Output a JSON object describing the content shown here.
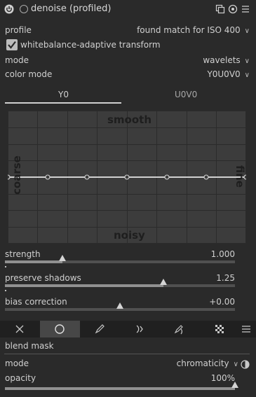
{
  "header": {
    "title": "denoise (profiled)"
  },
  "profile": {
    "label": "profile",
    "value": "found match for ISO 400"
  },
  "whitebalance": {
    "label": "whitebalance-adaptive transform",
    "checked": true
  },
  "mode": {
    "label": "mode",
    "value": "wavelets"
  },
  "color_mode": {
    "label": "color mode",
    "value": "Y0U0V0"
  },
  "tabs": [
    {
      "label": "Y0",
      "active": true
    },
    {
      "label": "U0V0",
      "active": false
    }
  ],
  "graph": {
    "top": "smooth",
    "bottom": "noisy",
    "left": "coarse",
    "right": "fine"
  },
  "sliders": {
    "strength": {
      "label": "strength",
      "value": "1.000",
      "position": 0.25
    },
    "preserve": {
      "label": "preserve shadows",
      "value": "1.25",
      "position": 0.69
    },
    "bias": {
      "label": "bias correction",
      "value": "+0.00",
      "position": 0.5
    }
  },
  "blend": {
    "icons": [
      "off-icon",
      "uniformly-icon",
      "drawn-mask-icon",
      "parametric-mask-icon",
      "drawn-parametric-mask-icon",
      "raster-mask-icon",
      "menu-icon"
    ],
    "selected": "uniformly-icon",
    "section": "blend mask",
    "mode_label": "mode",
    "mode_value": "chromaticity",
    "opacity_label": "opacity",
    "opacity_value": "100%",
    "opacity_position": 1.0
  }
}
